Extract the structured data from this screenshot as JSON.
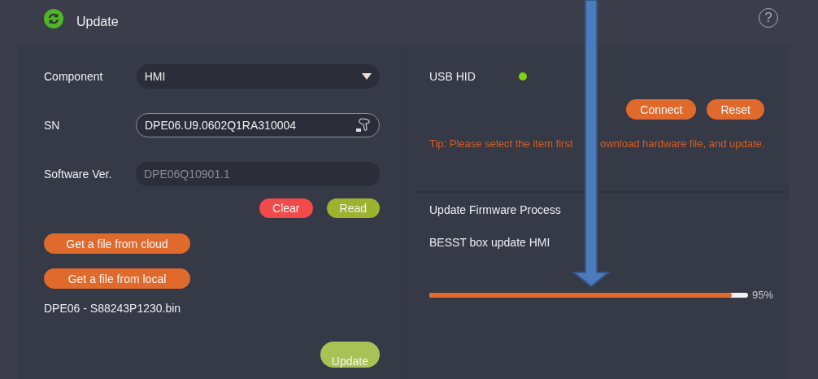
{
  "header": {
    "title": "Update",
    "help": "?"
  },
  "form": {
    "component": {
      "label": "Component",
      "value": "HMI"
    },
    "sn": {
      "label": "SN",
      "value": "DPE06.U9.0602Q1RA310004"
    },
    "software_ver": {
      "label": "Software Ver.",
      "placeholder": "DPE06Q10901.1"
    }
  },
  "form_buttons": [
    {
      "label": "Clear",
      "color": "#f04a4a"
    },
    {
      "label": "Read",
      "color": "#9db22f"
    }
  ],
  "file_buttons": [
    "Get a file from cloud",
    "Get a file from local"
  ],
  "file_name": "DPE06 - S88243P1230.bin",
  "update_button": "Update",
  "connection": {
    "label": "USB HID",
    "connected": true
  },
  "connection_buttons": [
    "Connect",
    "Reset"
  ],
  "tip": [
    "Tip: Please select the item first",
    "ownload hardware file, and update."
  ],
  "process": {
    "title": "Update Firmware Process",
    "task": "BESST box update HMI",
    "level": 0.95,
    "reading": "95%"
  }
}
